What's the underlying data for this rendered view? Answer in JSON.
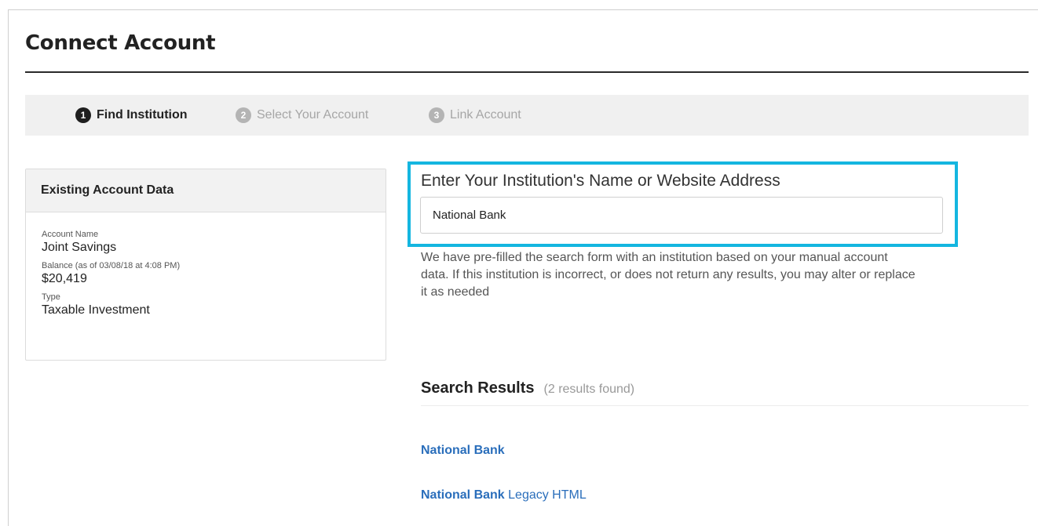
{
  "page": {
    "title": "Connect Account"
  },
  "stepper": {
    "steps": [
      {
        "number": "1",
        "label": "Find Institution",
        "state": "active"
      },
      {
        "number": "2",
        "label": "Select Your Account",
        "state": "inactive"
      },
      {
        "number": "3",
        "label": "Link Account",
        "state": "inactive"
      }
    ]
  },
  "existing_account": {
    "header": "Existing Account Data",
    "account_name_label": "Account Name",
    "account_name": "Joint Savings",
    "balance_label": "Balance (as of 03/08/18 at 4:08 PM)",
    "balance": "$20,419",
    "type_label": "Type",
    "type": "Taxable Investment"
  },
  "search": {
    "label": "Enter Your Institution's Name or Website Address",
    "value": "National Bank",
    "help_text": "We have pre-filled the search form with an institution based on your manual account data. If this institution is incorrect, or does not return any results, you may alter or replace it as needed"
  },
  "results": {
    "title": "Search Results",
    "count_text": "(2 results found)",
    "items": [
      {
        "name": "National Bank",
        "suffix": ""
      },
      {
        "name": "National Bank",
        "suffix": "Legacy HTML"
      }
    ]
  },
  "colors": {
    "highlight": "#14b6e0",
    "link": "#2a6ebb",
    "step_active": "#1e1e1e",
    "step_inactive": "#b4b4b4"
  }
}
